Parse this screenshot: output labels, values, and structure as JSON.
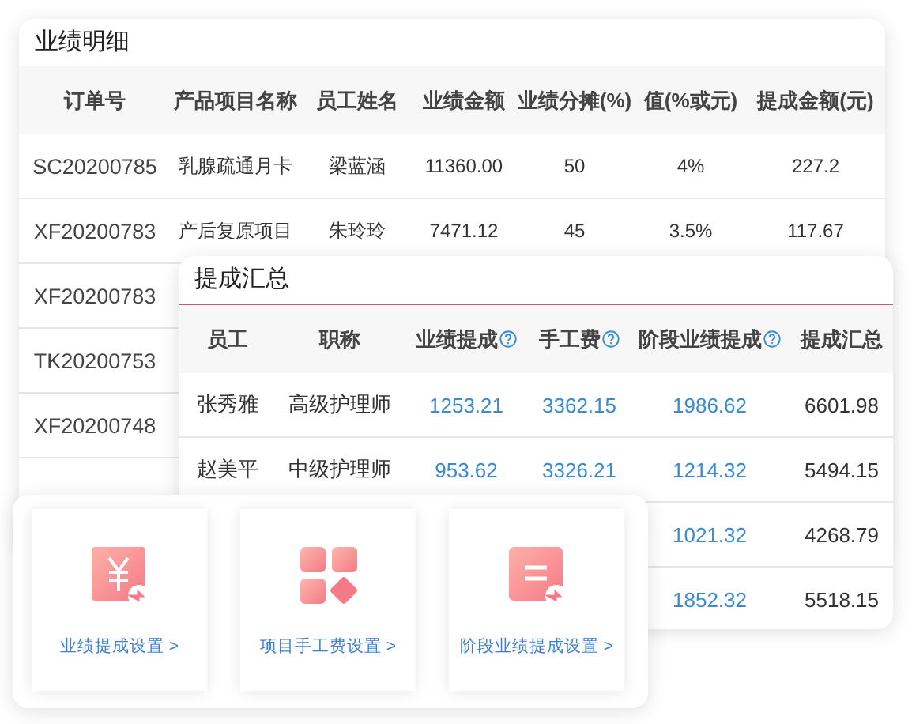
{
  "detail": {
    "title": "业绩明细",
    "columns": [
      "订单号",
      "产品项目名称",
      "员工姓名",
      "业绩金额",
      "业绩分摊(%)",
      "值(%或元)",
      "提成金额(元)"
    ],
    "rows": [
      {
        "order_no": "SC20200785",
        "product": "乳腺疏通月卡",
        "employee": "梁蓝涵",
        "amount": "11360.00",
        "share": "50",
        "value": "4%",
        "commission": "227.2"
      },
      {
        "order_no": "XF20200783",
        "product": "产后复原项目",
        "employee": "朱玲玲",
        "amount": "7471.12",
        "share": "45",
        "value": "3.5%",
        "commission": "117.67"
      },
      {
        "order_no": "XF20200783"
      },
      {
        "order_no": "TK20200753"
      },
      {
        "order_no": "XF20200748"
      }
    ]
  },
  "summary": {
    "title": "提成汇总",
    "columns": [
      {
        "label": "员工",
        "help": false,
        "kind": "text"
      },
      {
        "label": "职称",
        "help": false,
        "kind": "text"
      },
      {
        "label": "业绩提成",
        "help": true,
        "kind": "link"
      },
      {
        "label": "手工费",
        "help": true,
        "kind": "link"
      },
      {
        "label": "阶段业绩提成",
        "help": true,
        "kind": "link"
      },
      {
        "label": "提成汇总",
        "help": false,
        "kind": "text"
      }
    ],
    "rows": [
      {
        "cells": [
          "张秀雅",
          "高级护理师",
          "1253.21",
          "3362.15",
          "1986.62",
          "6601.98"
        ]
      },
      {
        "cells": [
          "赵美平",
          "中级护理师",
          "953.62",
          "3326.21",
          "1214.32",
          "5494.15"
        ]
      },
      {
        "cells": [
          null,
          null,
          null,
          null,
          "1021.32",
          "4268.79"
        ]
      },
      {
        "cells": [
          null,
          null,
          null,
          null,
          "1852.32",
          "5518.15"
        ]
      }
    ]
  },
  "settings": [
    {
      "kind": "yuan",
      "label": "业绩提成设置 >"
    },
    {
      "kind": "blocks",
      "label": "项目手工费设置 >"
    },
    {
      "kind": "list",
      "label": "阶段业绩提成设置 >"
    }
  ]
}
